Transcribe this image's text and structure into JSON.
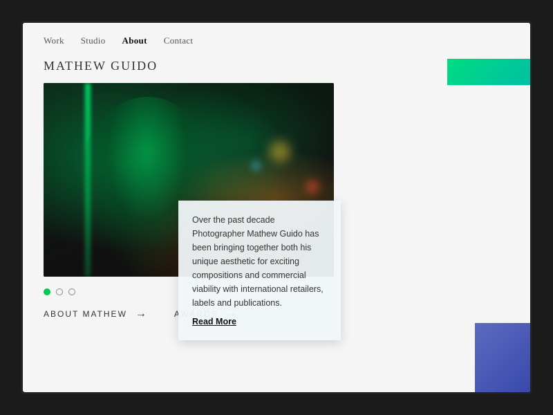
{
  "nav": {
    "items": [
      {
        "label": "Work",
        "active": false
      },
      {
        "label": "Studio",
        "active": false
      },
      {
        "label": "About",
        "active": true
      },
      {
        "label": "Contact",
        "active": false
      }
    ]
  },
  "page": {
    "title": "Mathew Guido"
  },
  "info_card": {
    "body": "Over the past decade Photographer Mathew Guido has been bringing together both his unique aesthetic for exciting compositions and commercial viability with international retailers, labels and publications.",
    "read_more": "Read More"
  },
  "carousel": {
    "dots": [
      {
        "active": true
      },
      {
        "active": false
      },
      {
        "active": false
      }
    ]
  },
  "bottom_links": [
    {
      "label": "About Mathew",
      "arrow": "→"
    },
    {
      "label": "Awards",
      "arrow": "→"
    }
  ],
  "decorators": {
    "corner_green": "top-right green gradient block",
    "corner_blue": "bottom-right blue gradient block"
  }
}
